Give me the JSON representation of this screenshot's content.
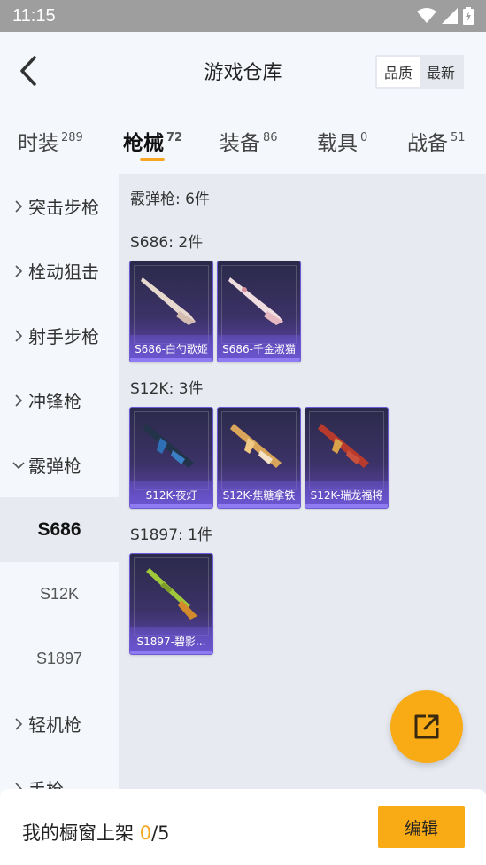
{
  "status_bar": {
    "time": "11:15"
  },
  "header": {
    "title": "游戏仓库",
    "sort_quality": "品质",
    "sort_latest": "最新"
  },
  "tabs": [
    {
      "label": "时装",
      "count": "289"
    },
    {
      "label": "枪械",
      "count": "72"
    },
    {
      "label": "装备",
      "count": "86"
    },
    {
      "label": "载具",
      "count": "0"
    },
    {
      "label": "战备",
      "count": "51"
    }
  ],
  "sidebar": {
    "cat_assault": "突击步枪",
    "cat_sniper": "栓动狙击",
    "cat_marksman": "射手步枪",
    "cat_smg": "冲锋枪",
    "cat_shotgun": "霰弹枪",
    "sub_s686": "S686",
    "sub_s12k": "S12K",
    "sub_s1897": "S1897",
    "cat_lmg": "轻机枪",
    "cat_pistol": "手枪"
  },
  "content": {
    "category_heading": "霰弹枪: 6件",
    "groups": [
      {
        "title": "S686: 2件",
        "items": [
          "S686-白勺歌姬",
          "S686-千金淑猫"
        ]
      },
      {
        "title": "S12K: 3件",
        "items": [
          "S12K-夜灯",
          "S12K-焦糖拿铁",
          "S12K-瑞龙福将"
        ]
      },
      {
        "title": "S1897: 1件",
        "items": [
          "S1897-碧影..."
        ]
      }
    ]
  },
  "bottom_bar": {
    "showcase_label": "我的橱窗上架",
    "showcase_count": "0",
    "showcase_total": "/5",
    "edit_label": "编辑"
  },
  "colors": {
    "accent": "#f9ab16",
    "card_purple": "#6a55cf",
    "card_dark": "#2b2a4a"
  }
}
